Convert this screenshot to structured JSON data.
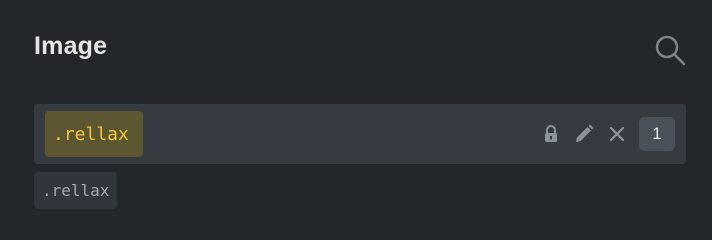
{
  "panel": {
    "title": "Image"
  },
  "selector": {
    "chip_label": ".rellax",
    "count": "1",
    "icons": [
      "lock-icon",
      "pencil-icon",
      "close-icon"
    ],
    "chip_color": "#5c5631",
    "chip_text_color": "#f4c53e"
  },
  "state_tag": {
    "label": ".rellax"
  },
  "search": {
    "icon": "search-icon"
  }
}
